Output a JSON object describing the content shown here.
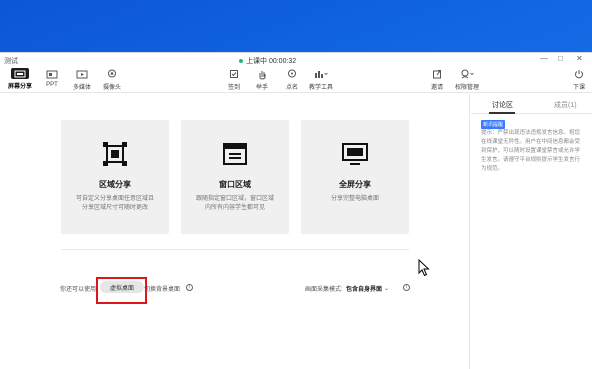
{
  "app": {
    "title": "测试",
    "live_status": "上课中 00:00:32",
    "live_color": "#2bb673"
  },
  "toolbar": {
    "left_items": [
      {
        "label": "屏幕分享",
        "icon": "screen-share-icon",
        "active": true
      },
      {
        "label": "PPT",
        "icon": "ppt-icon",
        "active": false
      },
      {
        "label": "多媒体",
        "icon": "media-play-icon",
        "active": false
      },
      {
        "label": "摄像头",
        "icon": "camera-icon",
        "active": false
      }
    ],
    "center_items": [
      {
        "label": "签到",
        "icon": "checkin-icon"
      },
      {
        "label": "举手",
        "icon": "raise-hand-icon"
      },
      {
        "label": "点名",
        "icon": "roll-call-icon"
      },
      {
        "label": "教学工具",
        "icon": "teaching-tools-icon"
      }
    ],
    "right_items": [
      {
        "label": "邀请",
        "icon": "invite-icon"
      },
      {
        "label": "权限管理",
        "icon": "permission-icon"
      },
      {
        "label": "下课",
        "icon": "end-class-icon"
      }
    ]
  },
  "cards": [
    {
      "title": "区域分享",
      "desc": "可自定义分享桌面任意区域且分享区域尺寸可随时更改",
      "icon": "region-share-icon"
    },
    {
      "title": "窗口区域",
      "desc": "跟随指定窗口区域，窗口区域内所有内容学生都可见",
      "icon": "window-region-icon"
    },
    {
      "title": "全屏分享",
      "desc": "分享完整电脑桌面",
      "icon": "fullscreen-share-icon"
    }
  ],
  "bottom": {
    "prefix": "你还可以使用",
    "virtual_desktop": "虚拟桌面",
    "switch_bg": "切换背景桌面",
    "capture_mode_label": "画面采集模式:",
    "capture_mode_value": "包含自身界面"
  },
  "side": {
    "tab_discuss": "讨论区",
    "tab_members": "成员(1)",
    "tip_badge": "新讯提醒",
    "tip_text": "提示：严禁出现违法违规发言信息。祝您在线课堂无异性。用户在中间信息都会受到保护，可以随时设置课堂禁言或允许学生发言。请遵守平台规则提示学生发言行为规范。"
  },
  "colors": {
    "accent": "#3a7afe",
    "highlight_box": "#e0151b",
    "desktop_blue": "#1570e8"
  }
}
